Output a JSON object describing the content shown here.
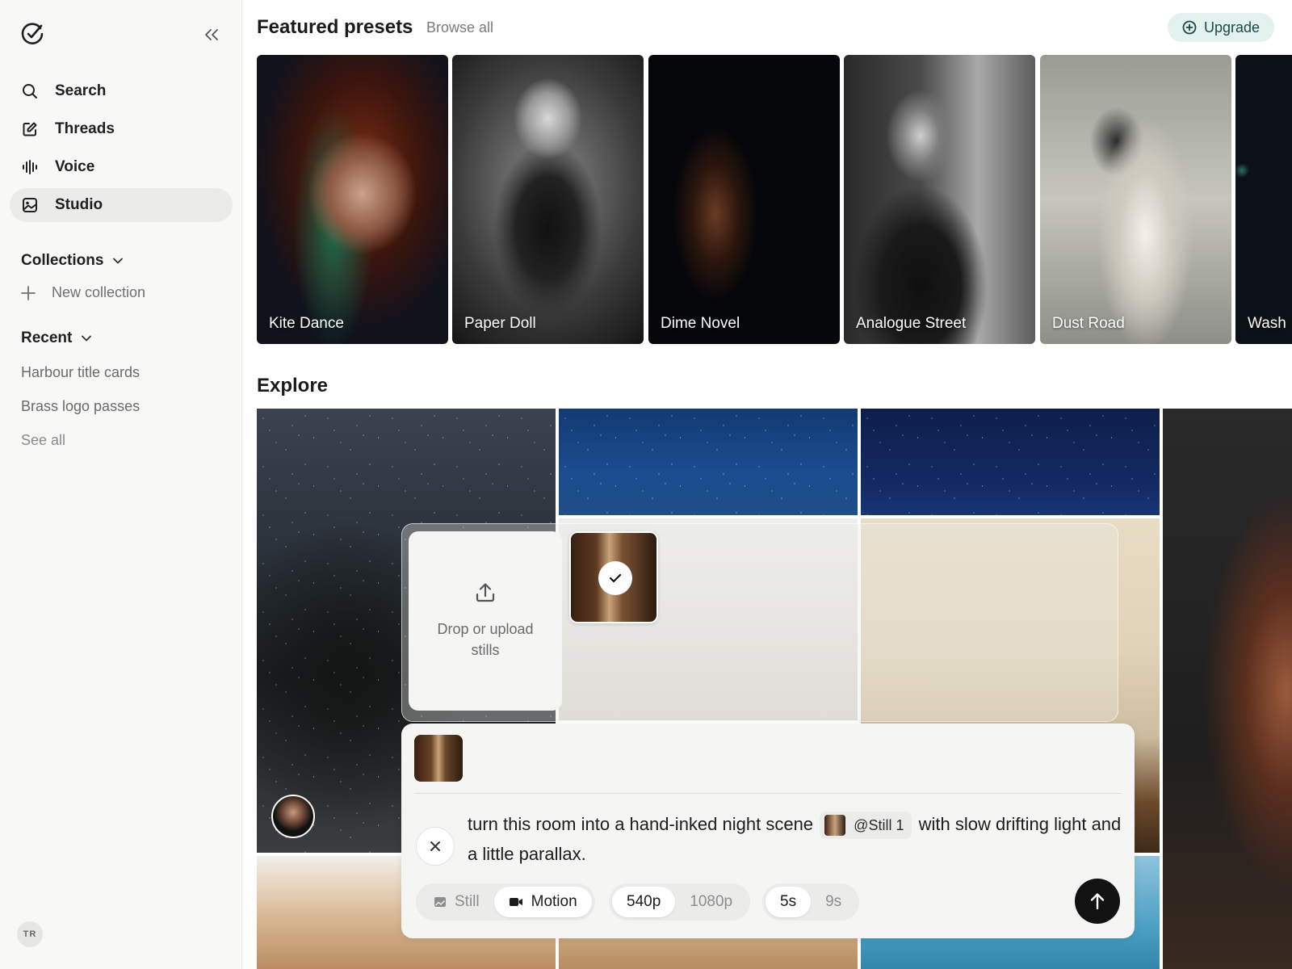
{
  "sidebar": {
    "nav": [
      {
        "label": "Search",
        "icon": "search-icon"
      },
      {
        "label": "Threads",
        "icon": "compose-icon"
      },
      {
        "label": "Voice",
        "icon": "waveform-icon"
      },
      {
        "label": "Studio",
        "icon": "image-icon",
        "active": true
      }
    ],
    "collections_label": "Collections",
    "new_collection_label": "New collection",
    "recent_label": "Recent",
    "recent_items": [
      "Harbour title cards",
      "Brass logo passes"
    ],
    "see_all_label": "See all",
    "user_initials": "TR"
  },
  "header": {
    "title": "Featured presets",
    "browse_all": "Browse all",
    "upgrade_label": "Upgrade",
    "upgrade_color": "#e3f1ef"
  },
  "presets": [
    {
      "name": "Kite Dance"
    },
    {
      "name": "Paper Doll"
    },
    {
      "name": "Dime Novel"
    },
    {
      "name": "Analogue Street"
    },
    {
      "name": "Dust Road"
    },
    {
      "name": "Wash"
    }
  ],
  "explore": {
    "title": "Explore"
  },
  "uploader": {
    "drop_text": "Drop or upload stills"
  },
  "composer": {
    "prompt_before": "turn this room into a hand-inked night scene",
    "mention_label": "@Still 1",
    "prompt_after": "with slow drifting light and a little parallax.",
    "mode_options": [
      {
        "label": "Still",
        "icon": "image-icon",
        "selected": false
      },
      {
        "label": "Motion",
        "icon": "video-icon",
        "selected": true
      }
    ],
    "resolution_options": [
      {
        "label": "540p",
        "selected": true
      },
      {
        "label": "1080p",
        "selected": false
      }
    ],
    "duration_options": [
      {
        "label": "5s",
        "selected": true
      },
      {
        "label": "9s",
        "selected": false
      }
    ]
  }
}
